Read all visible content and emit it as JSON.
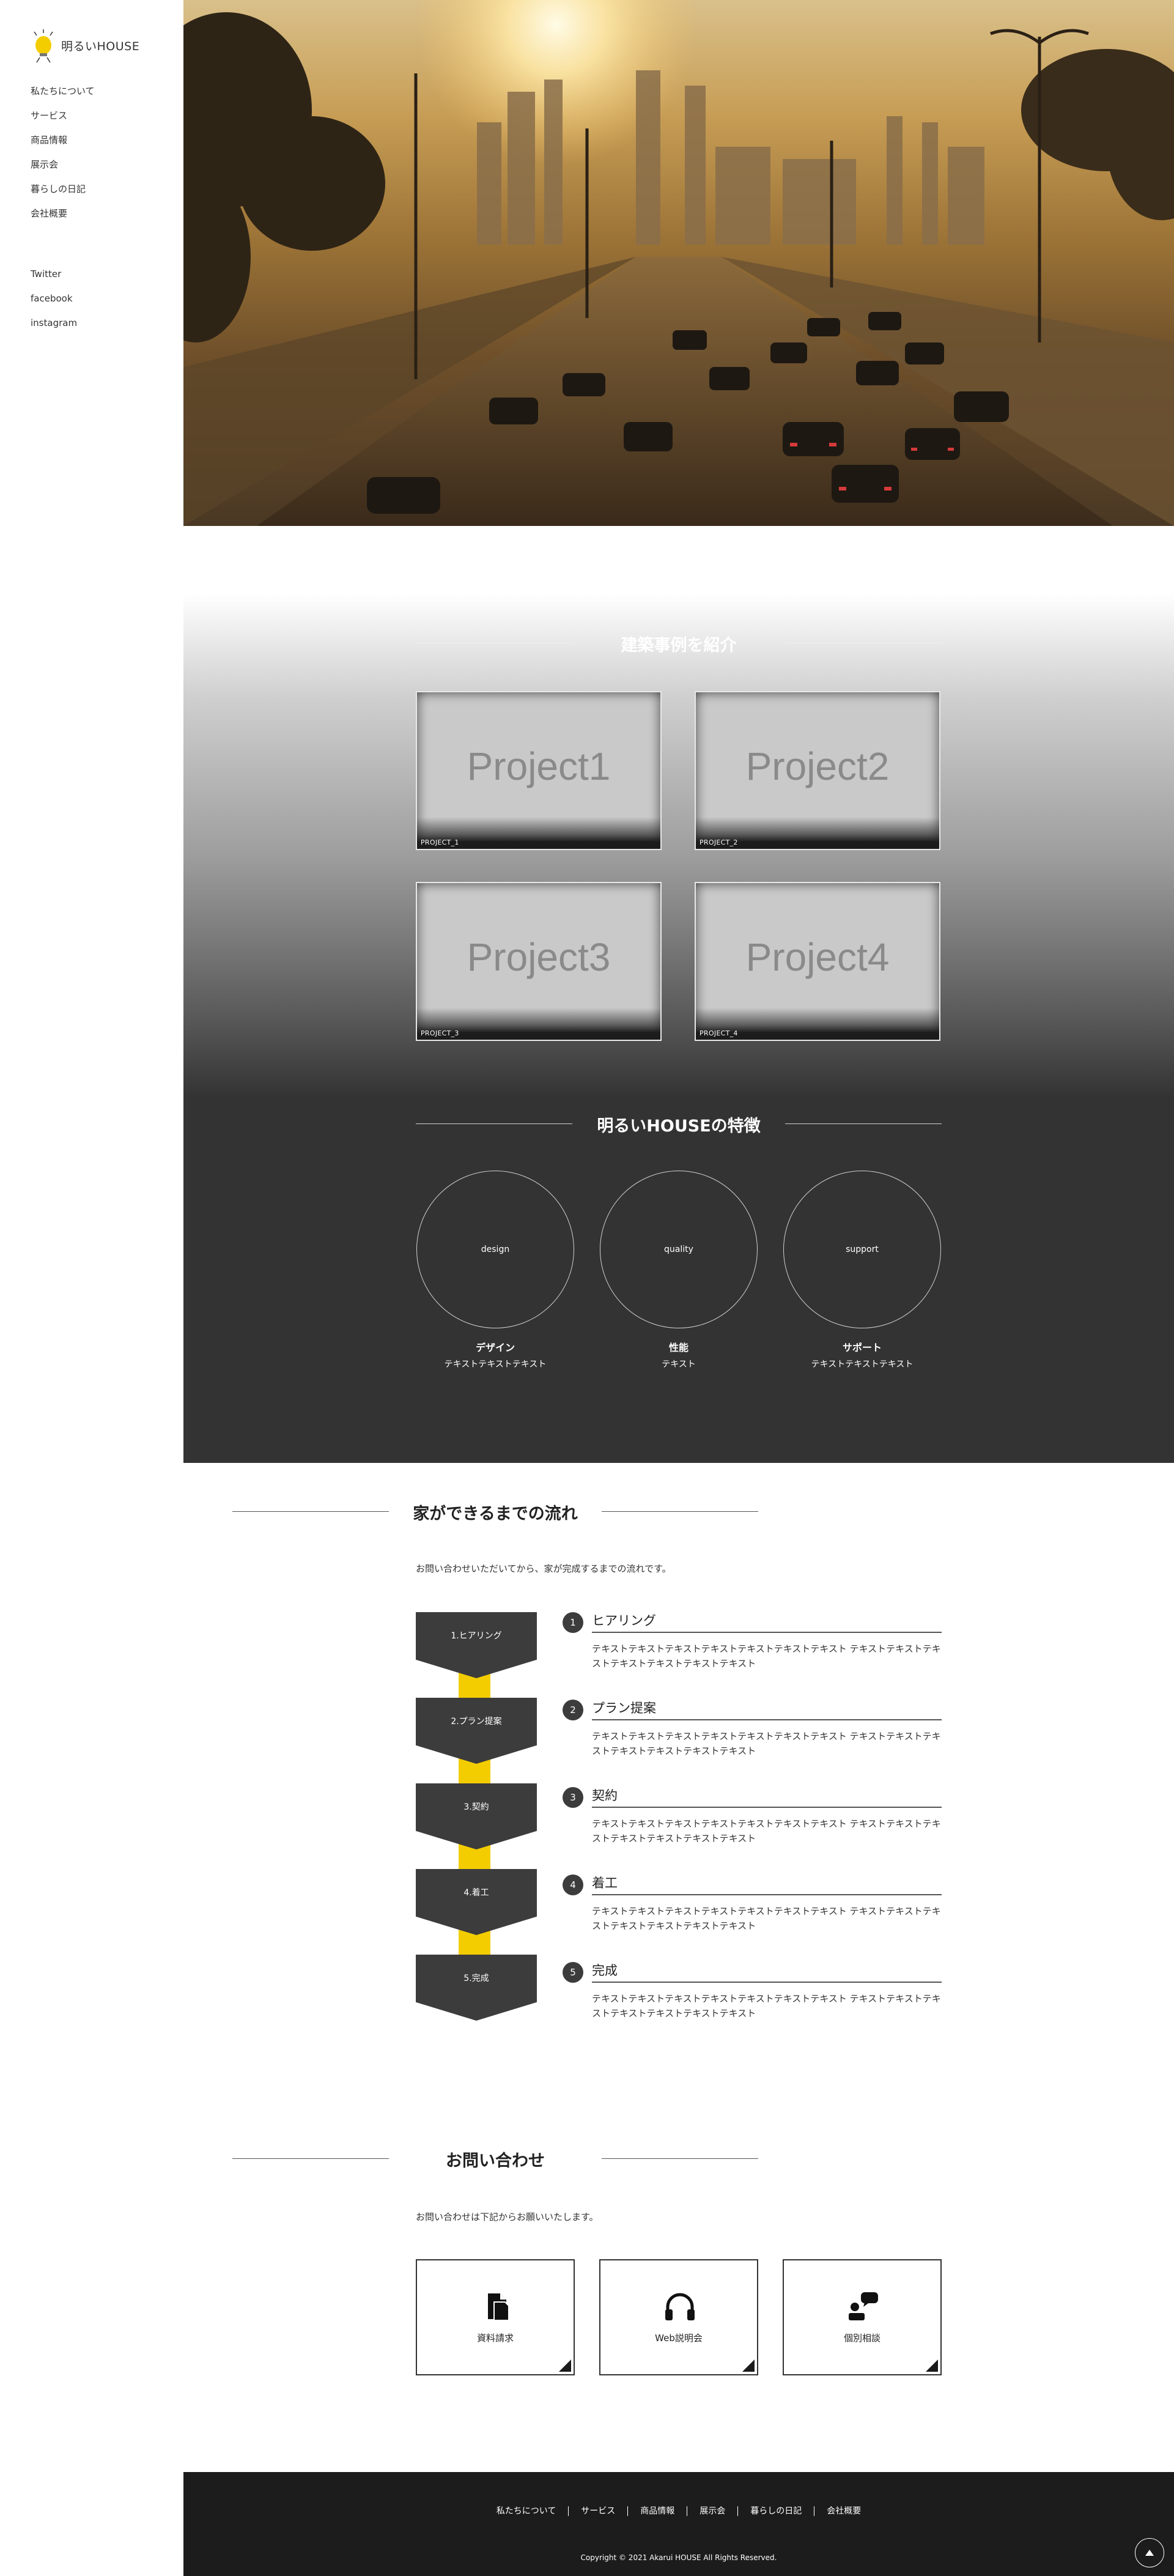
{
  "site": {
    "logo_text": "明るいHOUSE",
    "logo_icon": "light-bulb-icon",
    "brand_color": "#f3cd00"
  },
  "nav": {
    "items": [
      {
        "label": "私たちについて"
      },
      {
        "label": "サービス"
      },
      {
        "label": "商品情報"
      },
      {
        "label": "展示会"
      },
      {
        "label": "暮らしの日記"
      },
      {
        "label": "会社概要"
      }
    ],
    "social": [
      {
        "label": "Twitter"
      },
      {
        "label": "facebook"
      },
      {
        "label": "instagram"
      }
    ]
  },
  "hero": {
    "image": "city-highway-sunset-photo"
  },
  "works": {
    "heading": "建築事例を紹介",
    "projects": [
      {
        "title": "Project1",
        "label": "PROJECT_1"
      },
      {
        "title": "Project2",
        "label": "PROJECT_2"
      },
      {
        "title": "Project3",
        "label": "PROJECT_3"
      },
      {
        "title": "Project4",
        "label": "PROJECT_4"
      }
    ]
  },
  "features": {
    "heading": "明るいHOUSEの特徴",
    "items": [
      {
        "circle": "design",
        "title": "デザイン",
        "text": "テキストテキストテキスト"
      },
      {
        "circle": "quality",
        "title": "性能",
        "text": "テキスト"
      },
      {
        "circle": "support",
        "title": "サポート",
        "text": "テキストテキストテキスト"
      }
    ]
  },
  "flow": {
    "heading": "家ができるまでの流れ",
    "intro": "お問い合わせいただいてから、家が完成するまでの流れです。",
    "steps": [
      {
        "badge": "1.ヒアリング",
        "num": "1",
        "title": "ヒアリング",
        "text": "テキストテキストテキストテキストテキストテキストテキスト テキストテキストテキストテキストテキストテキストテキスト"
      },
      {
        "badge": "2.プラン提案",
        "num": "2",
        "title": "プラン提案",
        "text": "テキストテキストテキストテキストテキストテキストテキスト テキストテキストテキストテキストテキストテキストテキスト"
      },
      {
        "badge": "3.契約",
        "num": "3",
        "title": "契約",
        "text": "テキストテキストテキストテキストテキストテキストテキスト テキストテキストテキストテキストテキストテキストテキスト"
      },
      {
        "badge": "4.着工",
        "num": "4",
        "title": "着工",
        "text": "テキストテキストテキストテキストテキストテキストテキスト テキストテキストテキストテキストテキストテキストテキスト"
      },
      {
        "badge": "5.完成",
        "num": "5",
        "title": "完成",
        "text": "テキストテキストテキストテキストテキストテキストテキスト テキストテキストテキストテキストテキストテキストテキスト"
      }
    ]
  },
  "contact": {
    "heading": "お問い合わせ",
    "intro": "お問い合わせは下記からお願いいたします。",
    "items": [
      {
        "label": "資料請求",
        "icon": "document-icon"
      },
      {
        "label": "Web説明会",
        "icon": "headphones-icon"
      },
      {
        "label": "個別相談",
        "icon": "consultation-icon"
      }
    ]
  },
  "footer": {
    "links": [
      {
        "label": "私たちについて"
      },
      {
        "label": "サービス"
      },
      {
        "label": "商品情報"
      },
      {
        "label": "展示会"
      },
      {
        "label": "暮らしの日記"
      },
      {
        "label": "会社概要"
      }
    ],
    "copyright": "Copyright © 2021 Akarui HOUSE All Rights Reserved.",
    "to_top_icon": "arrow-up-icon"
  }
}
